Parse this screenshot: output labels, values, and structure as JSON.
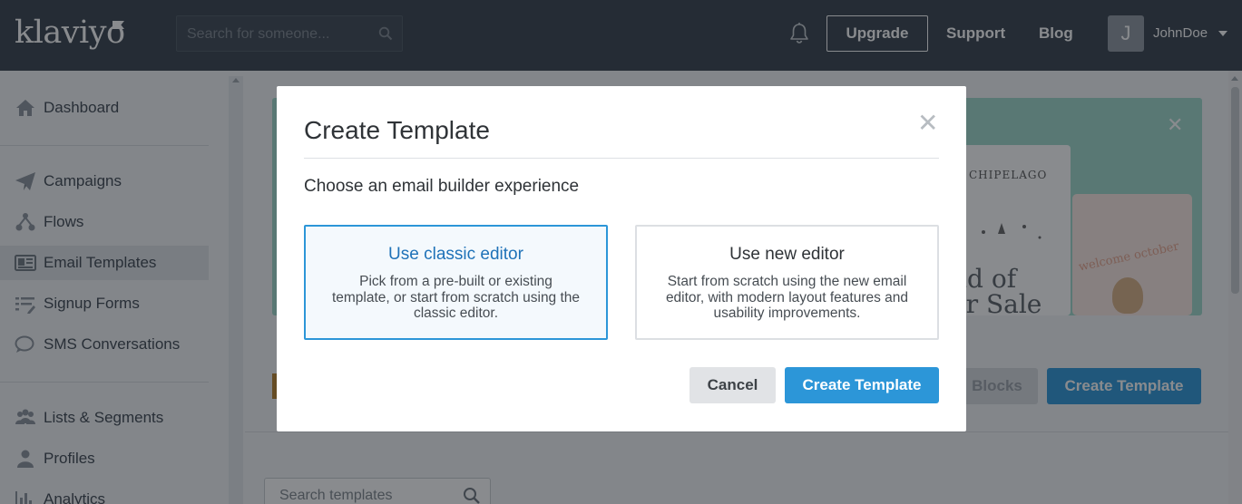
{
  "brand": {
    "logo_text": "klaviyo"
  },
  "header": {
    "search_placeholder": "Search for someone...",
    "upgrade_label": "Upgrade",
    "support_label": "Support",
    "blog_label": "Blog",
    "avatar_initial": "J",
    "username": "JohnDoe"
  },
  "sidebar": {
    "items": [
      {
        "label": "Dashboard",
        "icon": "home-icon"
      },
      {
        "label": "Campaigns",
        "icon": "paper-plane-icon"
      },
      {
        "label": "Flows",
        "icon": "flow-icon"
      },
      {
        "label": "Email Templates",
        "icon": "template-icon",
        "active": true
      },
      {
        "label": "Signup Forms",
        "icon": "form-list-icon"
      },
      {
        "label": "SMS Conversations",
        "icon": "chat-bubble-icon"
      },
      {
        "label": "Lists & Segments",
        "icon": "people-icon"
      },
      {
        "label": "Profiles",
        "icon": "person-icon"
      },
      {
        "label": "Analytics",
        "icon": "bar-chart-icon"
      }
    ]
  },
  "background": {
    "banner_card1_brand": "CHIPELAGO",
    "banner_card1_text": "nd of\nar Sale",
    "banner_card2_text": "welcome october",
    "blocks_label": "Blocks",
    "create_template_label": "Create Template",
    "search_templates_placeholder": "Search templates"
  },
  "modal": {
    "title": "Create Template",
    "subtitle": "Choose an email builder experience",
    "options": [
      {
        "title": "Use classic editor",
        "description": "Pick from a pre-built or existing template, or start from scratch using the classic editor.",
        "selected": true
      },
      {
        "title": "Use new editor",
        "description": "Start from scratch using the new email editor, with modern layout features and usability improvements.",
        "selected": false
      }
    ],
    "cancel_label": "Cancel",
    "create_label": "Create Template"
  },
  "colors": {
    "topbar": "#36414c",
    "accent": "#2c96d8",
    "banner": "#9ed9ca"
  }
}
